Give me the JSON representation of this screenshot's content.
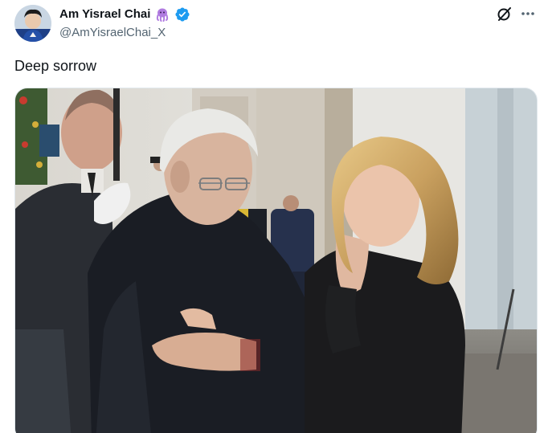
{
  "author": {
    "display_name": "Am Yisrael Chai",
    "handle": "@AmYisraelChai_X",
    "name_emoji": "octopus-emoji",
    "verified": true,
    "verified_color": "#1d9bf0"
  },
  "tweet": {
    "text": "Deep sorrow"
  },
  "actions": {
    "grok_icon": "grok-icon",
    "more_icon": "more-horizontal-icon"
  },
  "media": {
    "type": "photo",
    "content": "photo"
  },
  "colors": {
    "text_primary": "#0f1419",
    "text_secondary": "#536471",
    "accent": "#1d9bf0",
    "emoji": "#b07be0"
  }
}
